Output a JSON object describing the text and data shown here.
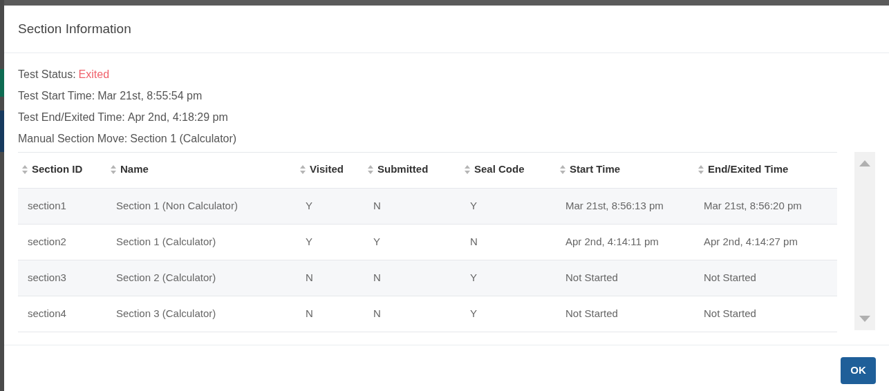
{
  "dialog": {
    "title": "Section Information"
  },
  "fields": [
    {
      "label": "Test Status:",
      "value": "Exited",
      "kind": "status"
    },
    {
      "label": "Test Start Time:",
      "value": "Mar 21st, 8:55:54 pm",
      "kind": "plain"
    },
    {
      "label": "Test End/Exited Time:",
      "value": "Apr 2nd, 4:18:29 pm",
      "kind": "plain"
    },
    {
      "label": "Manual Section Move:",
      "value": "Section 1 (Calculator)",
      "kind": "plain"
    }
  ],
  "table": {
    "columns": [
      "Section ID",
      "Name",
      "Visited",
      "Submitted",
      "Seal Code",
      "Start Time",
      "End/Exited Time"
    ],
    "rows": [
      [
        "section1",
        "Section 1 (Non Calculator)",
        "Y",
        "N",
        "Y",
        "Mar 21st, 8:56:13 pm",
        "Mar 21st, 8:56:20 pm"
      ],
      [
        "section2",
        "Section 1 (Calculator)",
        "Y",
        "Y",
        "N",
        "Apr 2nd, 4:14:11 pm",
        "Apr 2nd, 4:14:27 pm"
      ],
      [
        "section3",
        "Section 2 (Calculator)",
        "N",
        "N",
        "Y",
        "Not Started",
        "Not Started"
      ],
      [
        "section4",
        "Section 3 (Calculator)",
        "N",
        "N",
        "Y",
        "Not Started",
        "Not Started"
      ]
    ]
  },
  "buttons": [
    "OK"
  ]
}
